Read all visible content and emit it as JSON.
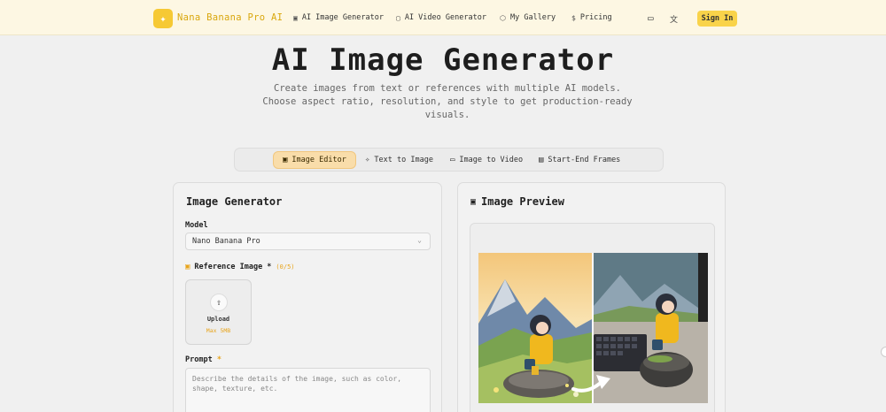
{
  "nav": {
    "brand": "Nana Banana Pro AI",
    "logo_glyph": "✦",
    "items": [
      {
        "label": "AI Image Generator",
        "icon": "image-icon",
        "glyph": "▣"
      },
      {
        "label": "AI Video Generator",
        "icon": "video-icon",
        "glyph": "▢"
      },
      {
        "label": "My Gallery",
        "icon": "gallery-icon",
        "glyph": "⬡"
      },
      {
        "label": "Pricing",
        "icon": "dollar-icon",
        "glyph": "$"
      }
    ],
    "chat_glyph": "▭",
    "lang_glyph": "文",
    "signin": "Sign In"
  },
  "hero": {
    "title": "AI Image Generator",
    "subtitle": "Create images from text or references with multiple AI models. Choose aspect ratio, resolution, and style to get production-ready visuals."
  },
  "tabs": [
    {
      "label": "Image Editor",
      "glyph": "▣"
    },
    {
      "label": "Text to Image",
      "glyph": "✧"
    },
    {
      "label": "Image to Video",
      "glyph": "▭"
    },
    {
      "label": "Start-End Frames",
      "glyph": "▤"
    }
  ],
  "generator": {
    "title": "Image Generator",
    "model_label": "Model",
    "model_value": "Nano Banana Pro",
    "ref_label": "Reference Image *",
    "ref_count": "(0/5)",
    "upload_label": "Upload",
    "upload_hint": "Max 5MB",
    "prompt_label": "Prompt",
    "prompt_required": "*",
    "prompt_placeholder": "Describe the details of the image, such as color, shape, texture, etc."
  },
  "preview": {
    "title": "Image Preview"
  },
  "colors": {
    "accent": "#f6c934",
    "tab_active": "#f9ddaa",
    "nav_bg": "#fdf7e3"
  }
}
